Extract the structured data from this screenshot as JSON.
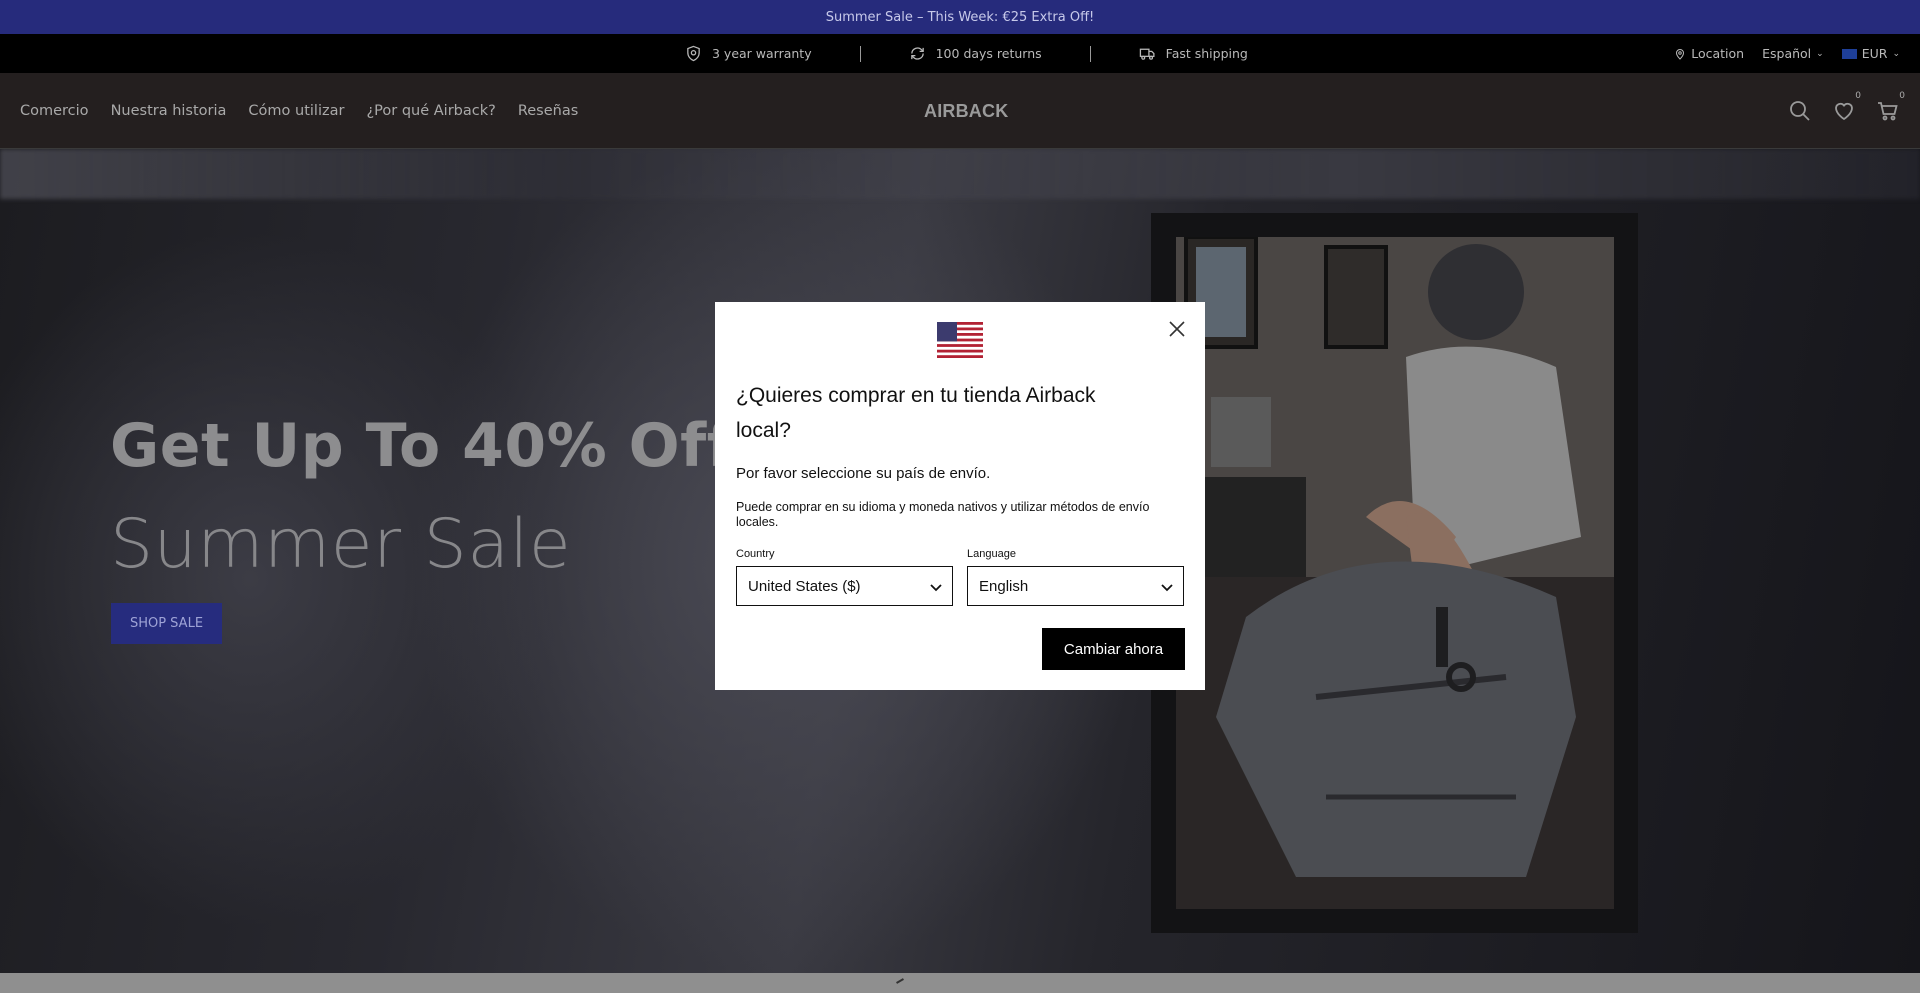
{
  "announcement": {
    "text": "Summer Sale – This Week: €25 Extra Off!"
  },
  "usp_bar": {
    "items": [
      {
        "icon": "shield-icon",
        "label": "3 year warranty"
      },
      {
        "icon": "refresh-icon",
        "label": "100 days returns"
      },
      {
        "icon": "truck-icon",
        "label": "Fast shipping"
      }
    ],
    "location_label": "Location",
    "language": "Español",
    "currency": "EUR"
  },
  "header": {
    "nav": [
      "Comercio",
      "Nuestra historia",
      "Cómo utilizar",
      "¿Por qué Airback?",
      "Reseñas"
    ],
    "logo": "AIRBACK",
    "wishlist_count": "0",
    "cart_count": "0"
  },
  "hero": {
    "title": "Get Up To 40% Off",
    "subtitle": "Summer Sale",
    "cta": "SHOP SALE"
  },
  "modal": {
    "flag_icon": "us-flag-icon",
    "title": "¿Quieres comprar en tu tienda Airback local?",
    "lead": "Por favor seleccione su país de envío.",
    "description": "Puede comprar en su idioma y moneda nativos y utilizar métodos de envío locales.",
    "country_label": "Country",
    "country_value": "United States ($)",
    "language_label": "Language",
    "language_value": "English",
    "submit": "Cambiar ahora"
  },
  "colors": {
    "announcement_bg": "#262b7c",
    "cta_bg": "#262c7e",
    "modal_bg": "#ffffff",
    "submit_bg": "#000000"
  }
}
